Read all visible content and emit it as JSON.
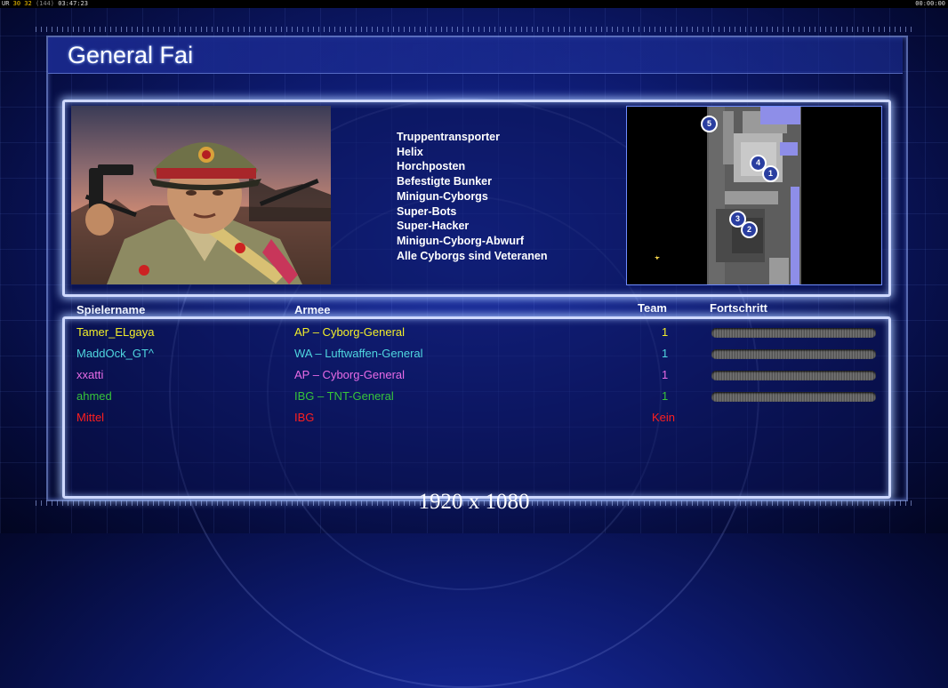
{
  "hud": {
    "left_prefix": "UR",
    "left_nums": "30 32",
    "left_bracket": "(144)",
    "left_time": "03:47:23",
    "right_time": "00:00:00"
  },
  "title": "General Fai",
  "units": [
    "Truppentransporter",
    "Helix",
    "Horchposten",
    "Befestigte Bunker",
    "Minigun-Cyborgs",
    "Super-Bots",
    "Super-Hacker",
    "Minigun-Cyborg-Abwurf",
    "Alle Cyborgs sind Veteranen"
  ],
  "minimap": {
    "markers": [
      "5",
      "4",
      "1",
      "3",
      "2"
    ]
  },
  "columns": {
    "name": "Spielername",
    "army": "Armee",
    "team": "Team",
    "progress": "Fortschritt"
  },
  "players": [
    {
      "name": "Tamer_ELgaya",
      "army": "AP – Cyborg-General",
      "team": "1",
      "color": "#f2ee2a",
      "progress_bar": true
    },
    {
      "name": "MaddOck_GT^",
      "army": "WA – Luftwaffen-General",
      "team": "1",
      "color": "#4fd6df",
      "progress_bar": true
    },
    {
      "name": "xxatti",
      "army": "AP – Cyborg-General",
      "team": "1",
      "color": "#e86be6",
      "progress_bar": true
    },
    {
      "name": "ahmed",
      "army": "IBG – TNT-General",
      "team": "1",
      "color": "#37c43a",
      "progress_bar": true
    },
    {
      "name": "Mittel",
      "army": "IBG",
      "team": "Kein",
      "color": "#ff1f1f",
      "progress_bar": false
    }
  ],
  "resolution": "1920 x 1080",
  "colors": {
    "accent": "#cfd9ff",
    "background": "#0d1a6e"
  }
}
